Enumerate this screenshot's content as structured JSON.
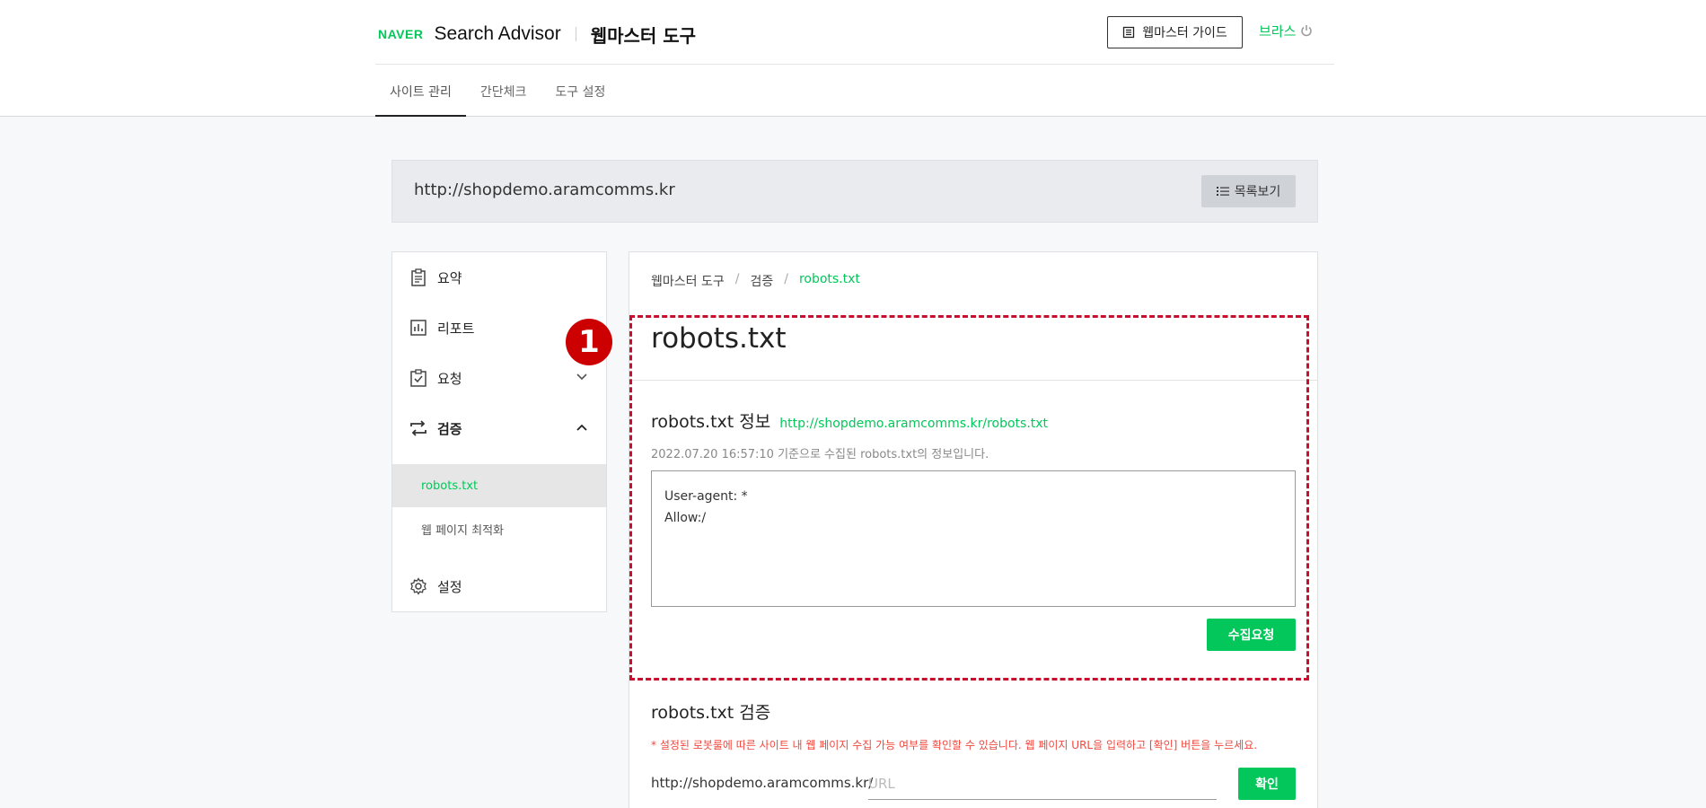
{
  "header": {
    "logo_text": "NAVER",
    "app_title": "Search Advisor",
    "app_subtitle": "웹마스터 도구",
    "guide_button": "웹마스터 가이드",
    "user_name": "브라스"
  },
  "tabs": [
    {
      "label": "사이트 관리",
      "active": true
    },
    {
      "label": "간단체크",
      "active": false
    },
    {
      "label": "도구 설정",
      "active": false
    }
  ],
  "site": {
    "url": "http://shopdemo.aramcomms.kr",
    "list_button": "목록보기"
  },
  "sidebar": {
    "items": [
      {
        "label": "요약",
        "icon": "clipboard-icon"
      },
      {
        "label": "리포트",
        "icon": "bar-chart-icon"
      },
      {
        "label": "요청",
        "icon": "clipboard-check-icon",
        "expanded": false
      },
      {
        "label": "검증",
        "icon": "repeat-icon",
        "expanded": true
      },
      {
        "label": "설정",
        "icon": "gear-icon"
      }
    ],
    "sub_items": [
      {
        "label": "robots.txt",
        "active": true
      },
      {
        "label": "웹 페이지 최적화",
        "active": false
      }
    ]
  },
  "annotation": {
    "badge": "1",
    "highlight_color": "#c8102e"
  },
  "main": {
    "breadcrumb": [
      "웹마스터 도구",
      "검증",
      "robots.txt"
    ],
    "title": "robots.txt",
    "info": {
      "title": "robots.txt 정보",
      "link": "http://shopdemo.aramcomms.kr/robots.txt",
      "date_note": "2022.07.20 16:57:10 기준으로 수집된 robots.txt의 정보입니다.",
      "content": "User-agent: *\nAllow:/",
      "collect_button": "수집요청"
    },
    "verify": {
      "title": "robots.txt 검증",
      "note": "* 설정된 로봇룰에 따른 사이트 내 웹 페이지 수집 가능 여부를 확인할 수 있습니다. 웹 페이지 URL을 입력하고 [확인] 버튼을 누르세요.",
      "base_url": "http://shopdemo.aramcomms.kr/",
      "input_placeholder": "URL",
      "input_value": "",
      "confirm_button": "확인"
    }
  },
  "colors": {
    "accent": "#03c75a",
    "warning_text": "#f0483e"
  }
}
